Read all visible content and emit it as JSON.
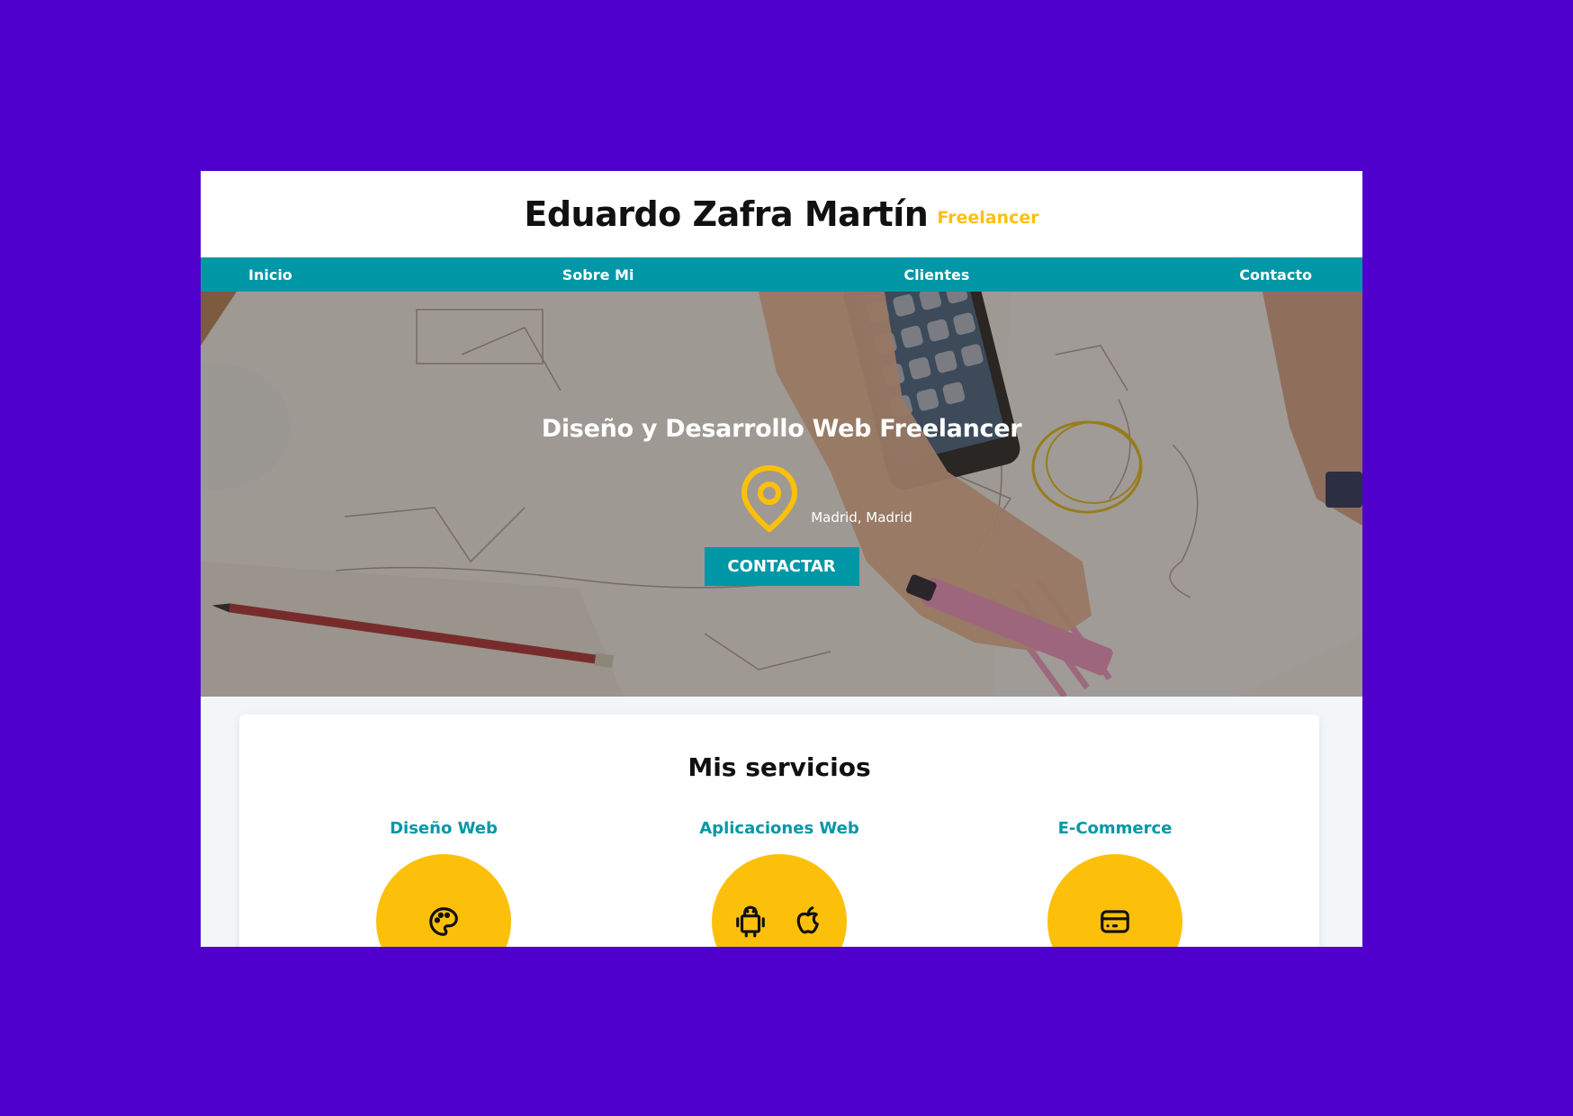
{
  "header": {
    "name": "Eduardo Zafra Martín",
    "tagline": "Freelancer"
  },
  "nav": {
    "items": [
      {
        "label": "Inicio"
      },
      {
        "label": "Sobre Mi"
      },
      {
        "label": "Clientes"
      },
      {
        "label": "Contacto"
      }
    ]
  },
  "hero": {
    "title": "Diseño y Desarrollo Web Freelancer",
    "location": "Madrid, Madrid",
    "location_icon": "map-pin-icon",
    "cta_label": "CONTACTAR"
  },
  "services": {
    "title": "Mis servicios",
    "items": [
      {
        "name": "Diseño Web",
        "icon": "palette-icon"
      },
      {
        "name": "Aplicaciones Web",
        "icons": [
          "android-icon",
          "apple-icon"
        ]
      },
      {
        "name": "E-Commerce",
        "icon": "credit-card-icon"
      }
    ]
  },
  "colors": {
    "page_background": "#5000cd",
    "accent_teal": "#0097a7",
    "accent_yellow": "#fdc00a",
    "text_dark": "#111111"
  }
}
